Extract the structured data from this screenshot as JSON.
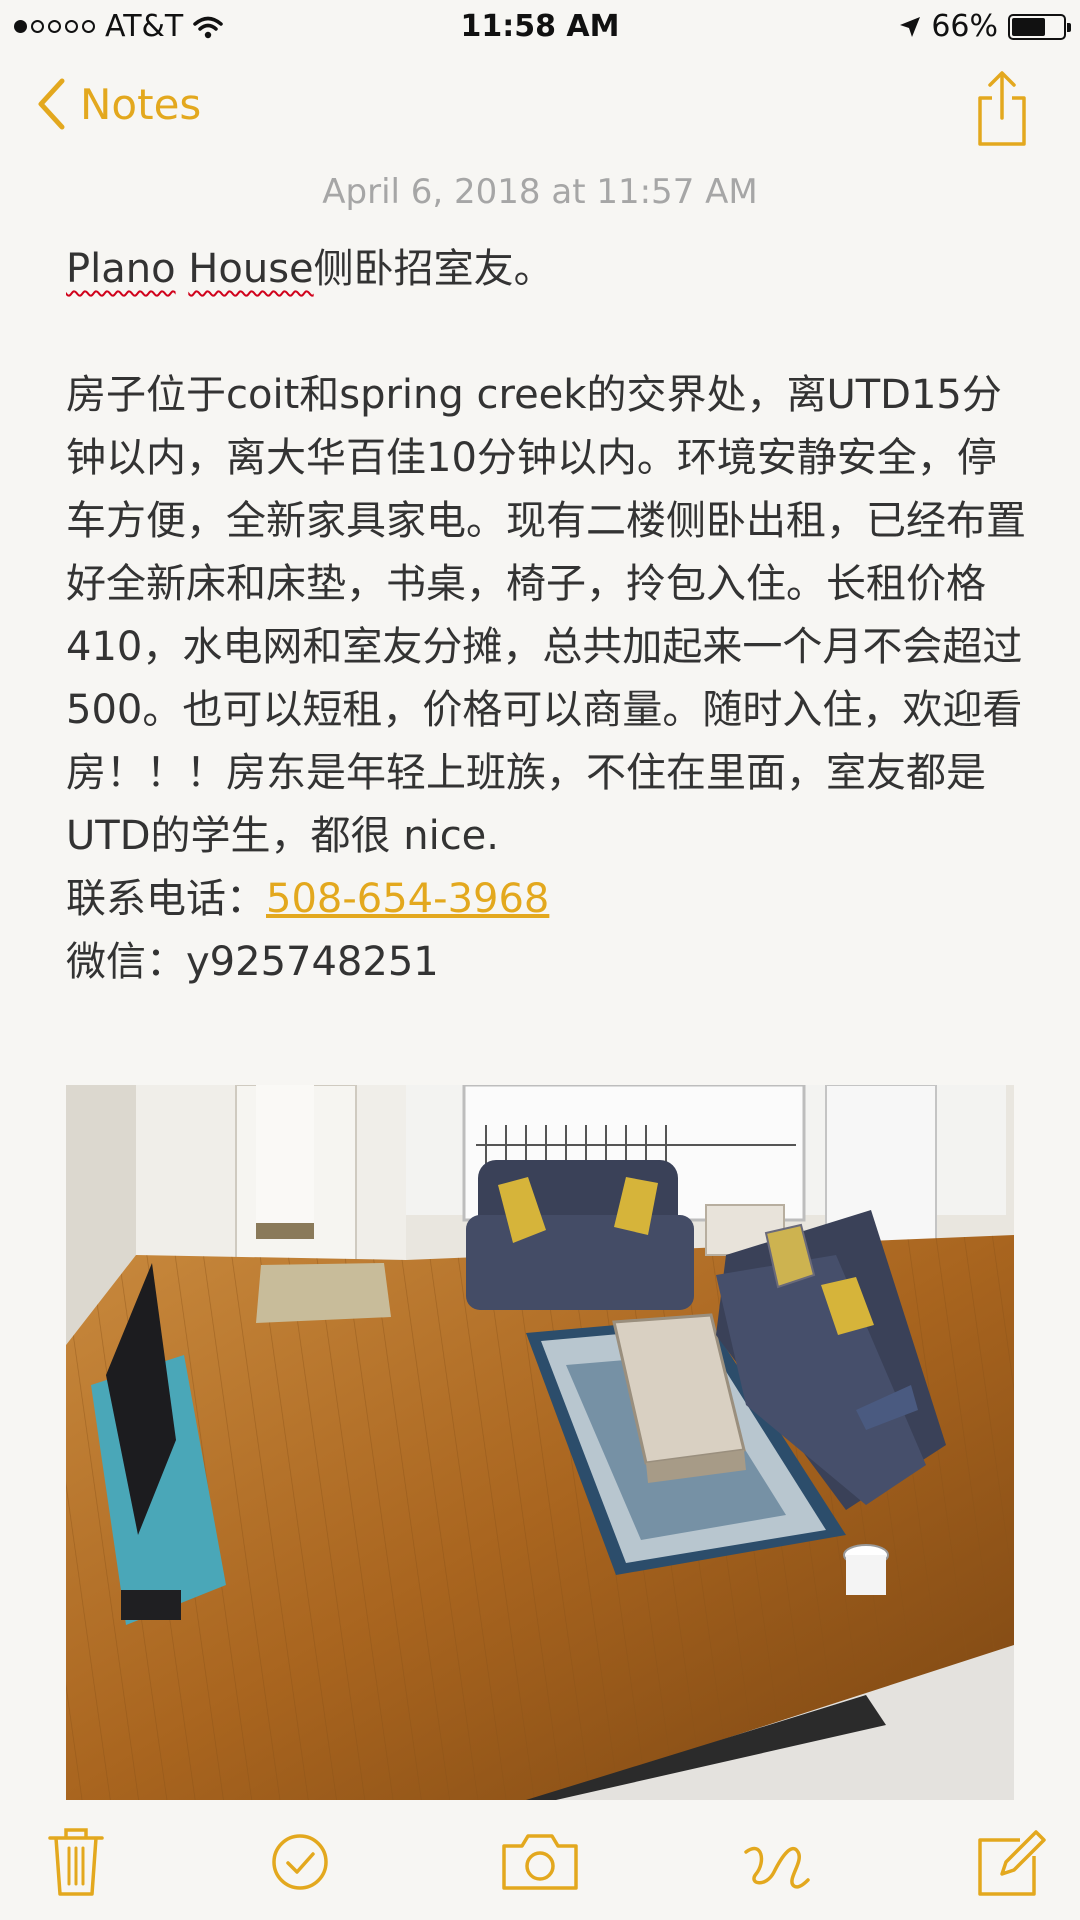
{
  "status_bar": {
    "carrier": "AT&T",
    "signal_bars_filled": 1,
    "signal_bars_total": 5,
    "wifi_icon": "wifi-icon",
    "time": "11:58 AM",
    "location_icon": "location-arrow-icon",
    "battery_percent": "66%",
    "battery_level": 0.66
  },
  "nav": {
    "back_label": "Notes",
    "back_icon": "chevron-left-icon",
    "share_icon": "share-icon"
  },
  "note": {
    "date": "April 6, 2018 at 11:57 AM",
    "title_part1": "Plano",
    "title_part2": "House",
    "title_rest": "侧卧招室友。",
    "body": "房子位于coit和spring creek的交界处，离UTD15分钟以内，离大华百佳10分钟以内。环境安静安全，停车方便，全新家具家电。现有二楼侧卧出租，已经布置好全新床和床垫，书桌，椅子，拎包入住。长租价格410，水电网和室友分摊，总共加起来一个月不会超过500。也可以短租，价格可以商量。随时入住，欢迎看房！！！房东是年轻上班族，不住在里面，室友都是UTD的学生，都很 nice.",
    "phone_label": "联系电话：",
    "phone_number": "508-654-3968",
    "wechat_label": "微信：",
    "wechat_id": "y925748251"
  },
  "toolbar": {
    "icons": [
      "trash-icon",
      "checklist-icon",
      "camera-icon",
      "sketch-icon",
      "compose-icon"
    ]
  },
  "colors": {
    "accent": "#e3a81e",
    "background": "#f7f6f3",
    "date_text": "#a6a6a6",
    "body_text": "#333333"
  }
}
